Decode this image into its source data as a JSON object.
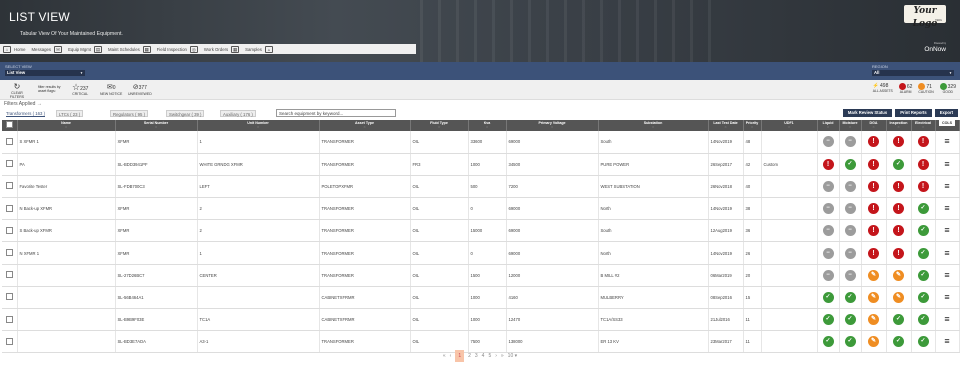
{
  "header": {
    "title": "LIST VIEW",
    "subtitle": "Tabular View Of Your Maintained Equipment.",
    "logo": "Your Logo",
    "logo_small": "HERE",
    "brand_small": "Powered by",
    "brand": "OnNow"
  },
  "nav": [
    {
      "label": "Home",
      "icon": "⌂"
    },
    {
      "label": "Messages",
      "icon": "✉"
    },
    {
      "label": "Equip Mgmt",
      "icon": "▤"
    },
    {
      "label": "Maint Schedules",
      "icon": "▦"
    },
    {
      "label": "Field Inspection",
      "icon": "◎"
    },
    {
      "label": "Work Orders",
      "icon": "▦"
    },
    {
      "label": "Samples",
      "icon": "▵"
    }
  ],
  "select_view": {
    "label": "SELECT VIEW",
    "value": "List View"
  },
  "region": {
    "label": "REGION",
    "value": "All"
  },
  "filters": {
    "clear": "CLEAR FILTERS",
    "filter_by": "filter results by asset flags:",
    "critical_count": "237",
    "critical": "CRITICAL",
    "new_notice_count": "0",
    "new_notice": "NEW NOTICE",
    "unreviewed_count": "377",
    "unreviewed": "UNREVIEWED"
  },
  "stats": [
    {
      "value": "498",
      "label": "ALL ASSETS",
      "color": ""
    },
    {
      "value": "62",
      "label": "ALARM",
      "color": "#c4151b"
    },
    {
      "value": "71",
      "label": "CAUTION",
      "color": "#ef8d22"
    },
    {
      "value": "329",
      "label": "GOOD",
      "color": "#3d9a3a"
    }
  ],
  "filters_applied": "Filters Applied →",
  "tabs": [
    "Transformers ( 163 )",
    "LTCs ( 23 )",
    "Regulators ( 95 )",
    "Switchgear ( 39 )",
    "Auxiliary ( 176 )"
  ],
  "search": {
    "placeholder": "Search equipment by keyword..."
  },
  "buttons": {
    "mark": "Mark Review Status",
    "print": "Print Reports",
    "export": "Export"
  },
  "columns": [
    "Name",
    "Serial Number",
    "Unit Number",
    "Asset Type",
    "Fluid Type",
    "Kva",
    "Primary Voltage",
    "Substation",
    "Last Test Date",
    "Priority",
    "UDF1",
    "Liquid",
    "Moisture",
    "DGA",
    "Inspection",
    "Electrical"
  ],
  "cols_btn": "COLS",
  "rows": [
    {
      "name": "S XFMR 1",
      "serial": "XFMR",
      "unit": "1",
      "type": "TRANSFORMER",
      "fluid": "OIL",
      "kva": "33600",
      "pv": "69000",
      "sub": "South",
      "date": "14Nov2019",
      "pri": "48",
      "udf": "",
      "st": [
        "g",
        "g",
        "rd",
        "rd",
        "rd"
      ]
    },
    {
      "name": "PA",
      "serial": "SL-BDD3941PF",
      "unit": "WHITE GRNDG XFMR",
      "type": "TRANSFORMER",
      "fluid": "FR3",
      "kva": "1000",
      "pv": "34500",
      "sub": "PURE POWER",
      "date": "26Sep2017",
      "pri": "42",
      "udf": "Custom",
      "st": [
        "rd",
        "gr",
        "rd",
        "gr",
        "rd"
      ]
    },
    {
      "name": "Favorite Tester",
      "serial": "SL-FDB700C3",
      "unit": "LEFT",
      "type": "POLETOPXFMR",
      "fluid": "OIL",
      "kva": "500",
      "pv": "7200",
      "sub": "WEST SUBSTATION",
      "date": "26Nov2018",
      "pri": "40",
      "udf": "",
      "st": [
        "g",
        "g",
        "rd",
        "rd",
        "rd"
      ]
    },
    {
      "name": "N Back-up XFMR",
      "serial": "XFMR",
      "unit": "2",
      "type": "TRANSFORMER",
      "fluid": "OIL",
      "kva": "0",
      "pv": "69000",
      "sub": "North",
      "date": "14Nov2019",
      "pri": "38",
      "udf": "",
      "st": [
        "g",
        "g",
        "rd",
        "rd",
        "gr"
      ]
    },
    {
      "name": "S Back-up XFMR",
      "serial": "XFMR",
      "unit": "2",
      "type": "TRANSFORMER",
      "fluid": "OIL",
      "kva": "15000",
      "pv": "69000",
      "sub": "South",
      "date": "12Aug2019",
      "pri": "36",
      "udf": "",
      "st": [
        "g",
        "g",
        "rd",
        "rd",
        "gr"
      ]
    },
    {
      "name": "N XFMR 1",
      "serial": "XFMR",
      "unit": "1",
      "type": "TRANSFORMER",
      "fluid": "OIL",
      "kva": "0",
      "pv": "69000",
      "sub": "North",
      "date": "14Nov2019",
      "pri": "26",
      "udf": "",
      "st": [
        "g",
        "g",
        "rd",
        "rd",
        "gr"
      ]
    },
    {
      "name": "",
      "serial": "SL-27D26BC7",
      "unit": "CENTER",
      "type": "TRANSFORMER",
      "fluid": "OIL",
      "kva": "1500",
      "pv": "12000",
      "sub": "B MILL #2",
      "date": "06Mar2019",
      "pri": "20",
      "udf": "",
      "st": [
        "g",
        "g",
        "or",
        "or",
        "gr"
      ]
    },
    {
      "name": "",
      "serial": "SL-56B464A1",
      "unit": "",
      "type": "CABINETXFRMR",
      "fluid": "OIL",
      "kva": "1000",
      "pv": "4160",
      "sub": "MULBERRY",
      "date": "08Sep2016",
      "pri": "15",
      "udf": "",
      "st": [
        "gr",
        "gr",
        "or",
        "or",
        "gr"
      ]
    },
    {
      "name": "",
      "serial": "SL-B9B9F03E",
      "unit": "TC1A",
      "type": "CABINETXFRMR",
      "fluid": "OIL",
      "kva": "1000",
      "pv": "12470",
      "sub": "TC1A/SS33",
      "date": "21Jul2016",
      "pri": "11",
      "udf": "",
      "st": [
        "gr",
        "gr",
        "or",
        "gr",
        "gr"
      ]
    },
    {
      "name": "",
      "serial": "SL-BD3E7ADA",
      "unit": "A3-1",
      "type": "TRANSFORMER",
      "fluid": "OIL",
      "kva": "7500",
      "pv": "138000",
      "sub": "ER 13 KV",
      "date": "23Mar2017",
      "pri": "11",
      "udf": "",
      "st": [
        "gr",
        "gr",
        "or",
        "gr",
        "gr"
      ]
    }
  ],
  "pagination": {
    "first": "«",
    "prev": "‹",
    "pages": [
      "1",
      "2",
      "3",
      "4",
      "5"
    ],
    "next": "›",
    "last": "»",
    "per_page": "10 ▾"
  },
  "status_icons": {
    "g": "−",
    "gr": "✓",
    "rd": "!",
    "or": "✎"
  }
}
